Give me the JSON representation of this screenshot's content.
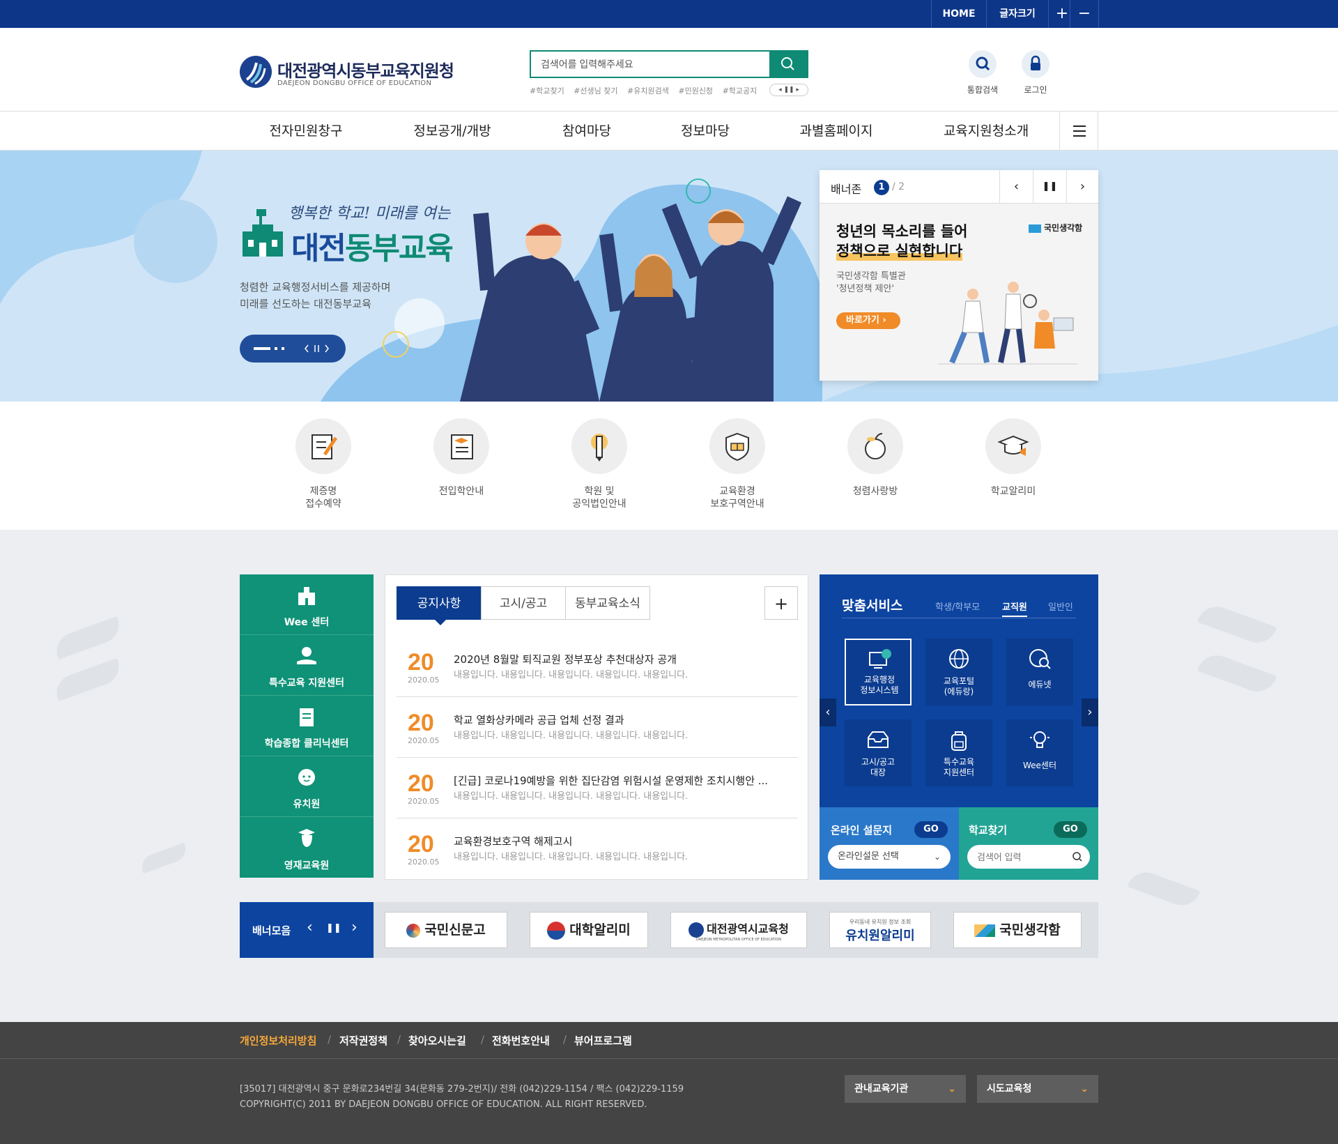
{
  "topbar": {
    "home": "HOME",
    "font_size": "글자크기",
    "plus": "+",
    "minus": "−"
  },
  "logo": {
    "title": "대전광역시동부교육지원청",
    "subtitle": "DAEJEON DONGBU OFFICE OF EDUCATION"
  },
  "search": {
    "placeholder": "검색어를 입력해주세요",
    "tags": [
      "#학교찾기",
      "#선생님 찾기",
      "#유치원검색",
      "#민원신청",
      "#학교공지"
    ]
  },
  "quick_links": {
    "unified_search": "통합검색",
    "login": "로그인"
  },
  "gnb": [
    "전자민원창구",
    "정보공개/개방",
    "참여마당",
    "정보마당",
    "과별홈페이지",
    "교육지원청소개"
  ],
  "hero": {
    "slogan": "행복한 학교! 미래를 여는",
    "title_part1": "대전",
    "title_part2": "동부교육",
    "desc_line1": "청렴한 교육행정서비스를 제공하며",
    "desc_line2": "미래를 선도하는 대전동부교육"
  },
  "banner_zone": {
    "label": "배너존",
    "current": "1",
    "total": "/ 2",
    "headline_line1": "청년의 목소리를 들어",
    "headline_line2": "정책으로 실현합니다",
    "brand": "국민생각함",
    "sub_line1": "국민생각함 특별관",
    "sub_line2": "'청년정책 제안'",
    "button": "바로가기"
  },
  "quick_icons": [
    {
      "line1": "제증명",
      "line2": "접수예약",
      "icon": "document-pen-icon"
    },
    {
      "line1": "전입학안내",
      "line2": "",
      "icon": "certificate-icon"
    },
    {
      "line1": "학원 및",
      "line2": "공익법인안내",
      "icon": "pencil-icon"
    },
    {
      "line1": "교육환경",
      "line2": "보호구역안내",
      "icon": "shield-book-icon"
    },
    {
      "line1": "청렴사랑방",
      "line2": "",
      "icon": "apple-icon"
    },
    {
      "line1": "학교알리미",
      "line2": "",
      "icon": "graduation-cap-icon"
    }
  ],
  "side_menu": [
    {
      "label": "Wee 센터",
      "icon": "school-icon"
    },
    {
      "label": "특수교육 지원센터",
      "icon": "hand-apple-icon"
    },
    {
      "label": "학습종합 클리닉센터",
      "icon": "book-icon"
    },
    {
      "label": "유치원",
      "icon": "child-face-icon"
    },
    {
      "label": "영재교육원",
      "icon": "graduate-head-icon"
    }
  ],
  "notice": {
    "tabs": [
      "공지사항",
      "고시/공고",
      "동부교육소식"
    ],
    "more": "+",
    "items": [
      {
        "day": "20",
        "ym": "2020.05",
        "title": "2020년 8월말 퇴직교원 정부포상 추천대상자 공개",
        "desc": "내용입니다. 내용입니다. 내용입니다. 내용입니다. 내용입니다."
      },
      {
        "day": "20",
        "ym": "2020.05",
        "title": "학교 열화상카메라 공급 업체 선정 결과",
        "desc": "내용입니다. 내용입니다. 내용입니다. 내용입니다. 내용입니다."
      },
      {
        "day": "20",
        "ym": "2020.05",
        "title": "[긴급] 코로나19예방을 위한 집단감염 위험시설 운영제한 조치시행안 ...",
        "desc": "내용입니다. 내용입니다. 내용입니다. 내용입니다. 내용입니다."
      },
      {
        "day": "20",
        "ym": "2020.05",
        "title": "교육환경보호구역 해제고시",
        "desc": "내용입니다. 내용입니다. 내용입니다. 내용입니다. 내용입니다."
      }
    ]
  },
  "service": {
    "title": "맞춤서비스",
    "tabs": [
      "학생/학부모",
      "교직원",
      "일반인"
    ],
    "tiles": [
      {
        "line1": "교육행정",
        "line2": "정보시스템",
        "icon": "monitor-icon"
      },
      {
        "line1": "교육포털",
        "line2": "(에듀랑)",
        "icon": "globe-icon"
      },
      {
        "line1": "에듀넷",
        "line2": "",
        "icon": "globe-search-icon"
      },
      {
        "line1": "고시/공고",
        "line2": "대장",
        "icon": "inbox-icon"
      },
      {
        "line1": "특수교육",
        "line2": "지원센터",
        "icon": "backpack-icon"
      },
      {
        "line1": "Wee센터",
        "line2": "",
        "icon": "lightbulb-icon"
      }
    ],
    "survey_title": "온라인 설문지",
    "survey_go": "GO",
    "survey_select": "온라인설문 선택",
    "school_title": "학교찾기",
    "school_go": "GO",
    "school_placeholder": "검색어 입력"
  },
  "banner_collection": {
    "label": "배너모음",
    "logos": [
      "국민신문고",
      "대학알리미",
      "대전광역시교육청",
      "유치원알리미",
      "국민생각함"
    ],
    "logo_sub_edu": "DAEJEON METROPOLITAN OFFICE OF EDUCATION",
    "logo_sub_kinder": "우리동네 유치원 정보 조회"
  },
  "footer": {
    "links": [
      "개인정보처리방침",
      "저작권정책",
      "찾아오시는길",
      "전화번호안내",
      "뷰어프로그램"
    ],
    "address": "[35017] 대전광역시 중구 문화로234번길 34(문화동 279-2번지)/ 전화 (042)229-1154 / 팩스 (042)229-1159",
    "copyright": "COPYRIGHT(C) 2011 BY DAEJEON DONGBU OFFICE OF EDUCATION. ALL RIGHT RESERVED.",
    "select1": "관내교육기관",
    "select2": "시도교육청"
  },
  "colors": {
    "navy": "#0d3689",
    "green": "#0f9277",
    "orange": "#f08b28",
    "service_blue": "#0c44a0",
    "footer": "#444444"
  }
}
